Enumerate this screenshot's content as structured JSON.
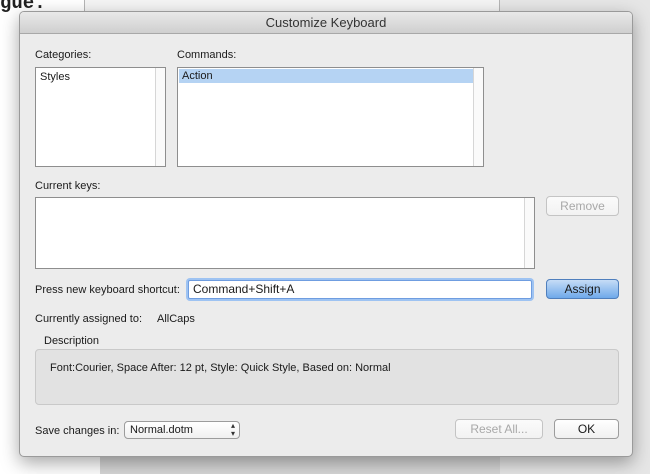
{
  "background": {
    "doc_text": "gue."
  },
  "dialog": {
    "title": "Customize Keyboard",
    "categories": {
      "label": "Categories:",
      "items": [
        "Styles"
      ]
    },
    "commands": {
      "label": "Commands:",
      "items": [
        "Action"
      ],
      "selected": "Action"
    },
    "current_keys": {
      "label": "Current keys:"
    },
    "remove_label": "Remove",
    "shortcut": {
      "label": "Press new keyboard shortcut:",
      "value": "Command+Shift+A"
    },
    "assign_label": "Assign",
    "assigned": {
      "label": "Currently assigned to:",
      "value": "AllCaps"
    },
    "description": {
      "label": "Description",
      "text": "Font:Courier, Space After:  12 pt, Style: Quick Style, Based on: Normal"
    },
    "save_in": {
      "label": "Save changes in:",
      "value": "Normal.dotm"
    },
    "reset_label": "Reset All...",
    "ok_label": "OK"
  },
  "colors": {
    "selection": "#b5d3f3",
    "default_button": "#6fa9ea",
    "focus_ring": "#9ec3f2"
  },
  "icons": [
    "up-down-arrows-icon"
  ]
}
